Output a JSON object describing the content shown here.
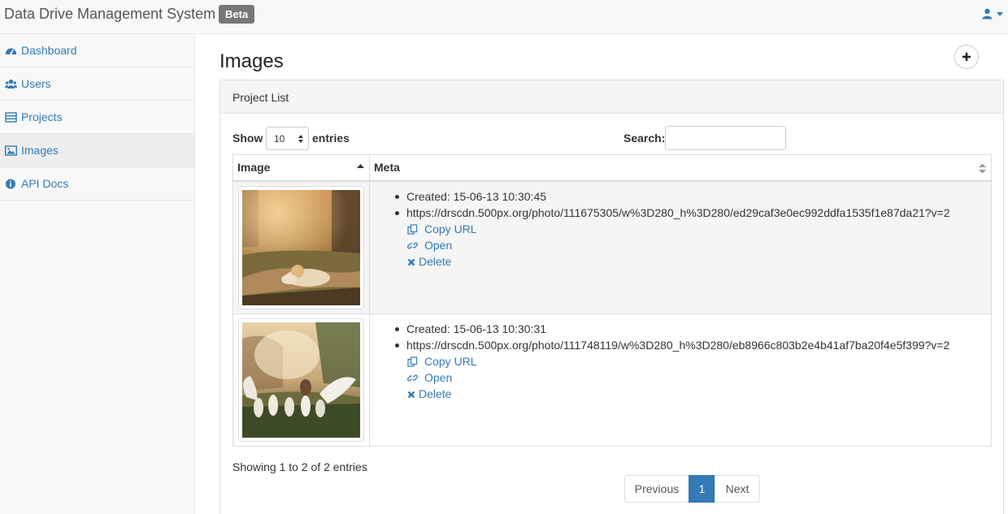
{
  "app": {
    "title": "Data Drive Management System",
    "badge": "Beta"
  },
  "sidebar": {
    "items": [
      {
        "label": "Dashboard",
        "icon": "dashboard-icon"
      },
      {
        "label": "Users",
        "icon": "users-icon"
      },
      {
        "label": "Projects",
        "icon": "list-icon"
      },
      {
        "label": "Images",
        "icon": "image-icon",
        "active": true
      },
      {
        "label": "API Docs",
        "icon": "info-icon"
      }
    ]
  },
  "page": {
    "title": "Images",
    "add_icon": "plus-icon"
  },
  "panel": {
    "title": "Project List",
    "show_label": "Show",
    "page_size": "10",
    "entries_label": "entries",
    "search_label": "Search:",
    "search_value": ""
  },
  "table": {
    "columns": [
      "Image",
      "Meta"
    ],
    "rows": [
      {
        "created": "Created: 15-06-13 10:30:45",
        "url": "https://drscdn.500px.org/photo/111675305/w%3D280_h%3D280/ed29caf3e0ec992ddfa1535f1e87da21?v=2",
        "copy_label": "Copy URL",
        "open_label": "Open",
        "delete_label": "Delete"
      },
      {
        "created": "Created: 15-06-13 10:30:31",
        "url": "https://drscdn.500px.org/photo/111748119/w%3D280_h%3D280/eb8966c803b2e4b41af7ba20f4e5f399?v=2",
        "copy_label": "Copy URL",
        "open_label": "Open",
        "delete_label": "Delete"
      }
    ]
  },
  "footer": {
    "info": "Showing 1 to 2 of 2 entries",
    "prev_label": "Previous",
    "current_page": "1",
    "next_label": "Next"
  },
  "colors": {
    "link": "#337ab7",
    "active_page": "#337ab7"
  }
}
